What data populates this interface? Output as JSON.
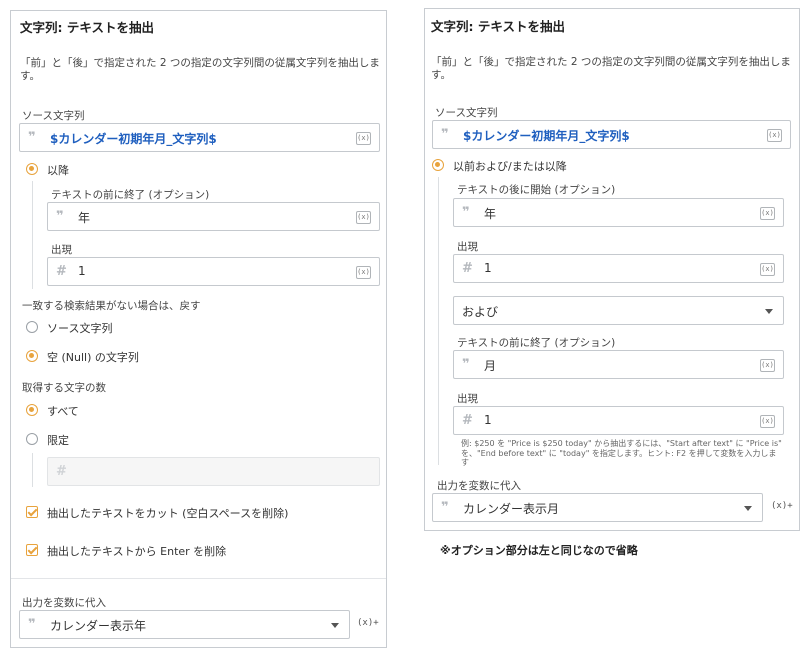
{
  "left": {
    "title": "文字列: テキストを抽出",
    "description": "「前」と「後」で指定された 2 つの指定の文字列間の従属文字列を抽出します。",
    "source_label": "ソース文字列",
    "source_value": "$カレンダー初期年月_文字列$",
    "mode_option": "以降",
    "end_before_label": "テキストの前に終了 (オプション)",
    "end_before_value": "年",
    "occurrence_label": "出現",
    "occurrence_value": "1",
    "no_match_label": "一致する検索結果がない場合は、戻す",
    "no_match_options": [
      "ソース文字列",
      "空 (Null) の文字列"
    ],
    "chars_label": "取得する文字の数",
    "chars_options": [
      "すべて",
      "限定"
    ],
    "trim_label": "抽出したテキストをカット (空白スペースを削除)",
    "enter_label": "抽出したテキストから Enter を削除",
    "output_label": "出力を変数に代入",
    "output_value": "カレンダー表示年"
  },
  "right": {
    "title": "文字列: テキストを抽出",
    "description": "「前」と「後」で指定された 2 つの指定の文字列間の従属文字列を抽出します。",
    "source_label": "ソース文字列",
    "source_value": "$カレンダー初期年月_文字列$",
    "mode_option": "以前および/または以降",
    "start_after_label": "テキストの後に開始 (オプション)",
    "start_after_value": "年",
    "occurrence1_label": "出現",
    "occurrence1_value": "1",
    "conjunction_value": "および",
    "end_before_label": "テキストの前に終了 (オプション)",
    "end_before_value": "月",
    "occurrence2_label": "出現",
    "occurrence2_value": "1",
    "hint": "例: $250 を \"Price is $250 today\" から抽出するには、\"Start after text\" に \"Price is\" を、\"End before text\" に \"today\" を指定します。ヒント: F2 を押して変数を入力します",
    "output_label": "出力を変数に代入",
    "output_value": "カレンダー表示月"
  },
  "note": "※オプション部分は左と同じなので省略",
  "glyphs": {
    "quote": "❞",
    "hash": "#",
    "var": "(x)",
    "var_plus": "(x)+"
  },
  "colors": {
    "accent": "#e8a33d",
    "variable": "#1f5fbf",
    "border": "#c5c9ce"
  }
}
